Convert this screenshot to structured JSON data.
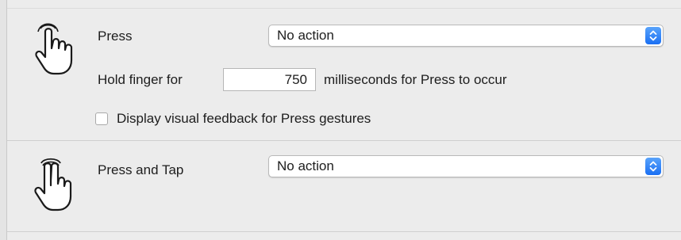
{
  "press": {
    "icon": "one-finger-press-icon",
    "label": "Press",
    "action_value": "No action",
    "hold_prefix": "Hold finger for",
    "hold_value": "750",
    "hold_suffix": "milliseconds for Press to occur",
    "feedback_label": "Display visual feedback for Press gestures",
    "feedback_checked": false
  },
  "press_and_tap": {
    "icon": "two-finger-press-tap-icon",
    "label": "Press and Tap",
    "action_value": "No action"
  },
  "colors": {
    "background": "#ececec",
    "popup_accent": "#1a6ff3"
  }
}
